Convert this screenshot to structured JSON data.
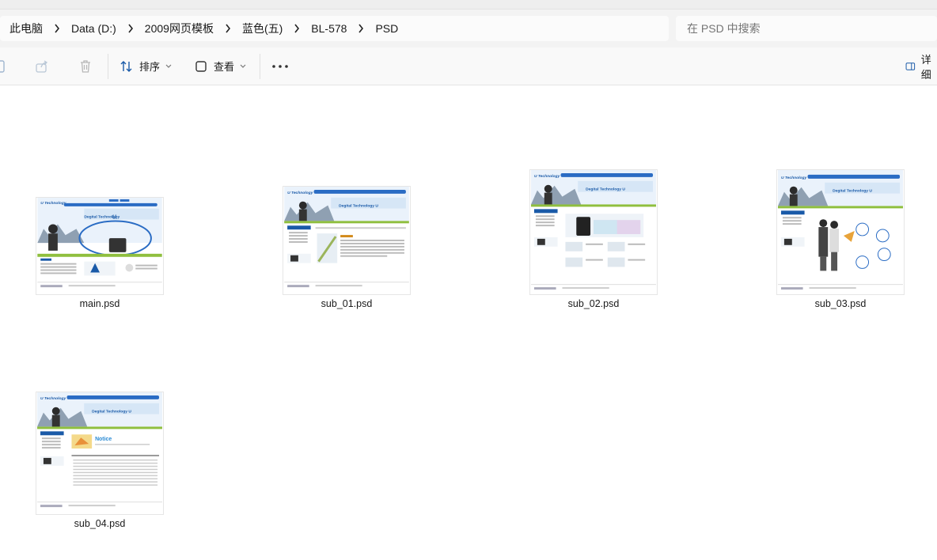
{
  "breadcrumb": {
    "items": [
      "此电脑",
      "Data (D:)",
      "2009网页模板",
      "蓝色(五)",
      "BL-578",
      "PSD"
    ]
  },
  "search": {
    "placeholder": "在 PSD 中搜索"
  },
  "toolbar": {
    "sort_label": "排序",
    "view_label": "查看",
    "details_label": "详细"
  },
  "files": [
    {
      "name": "main.psd"
    },
    {
      "name": "sub_01.psd"
    },
    {
      "name": "sub_02.psd"
    },
    {
      "name": "sub_03.psd"
    },
    {
      "name": "sub_04.psd"
    }
  ],
  "thumbnail_text": {
    "brand": "U Technology",
    "headline": "Degital Technology",
    "headline_mark": "U",
    "notice": "Notice"
  },
  "colors": {
    "accent": "#1a5aa8",
    "nav_blue": "#2a6cc4",
    "grass": "#8fbf3e"
  }
}
